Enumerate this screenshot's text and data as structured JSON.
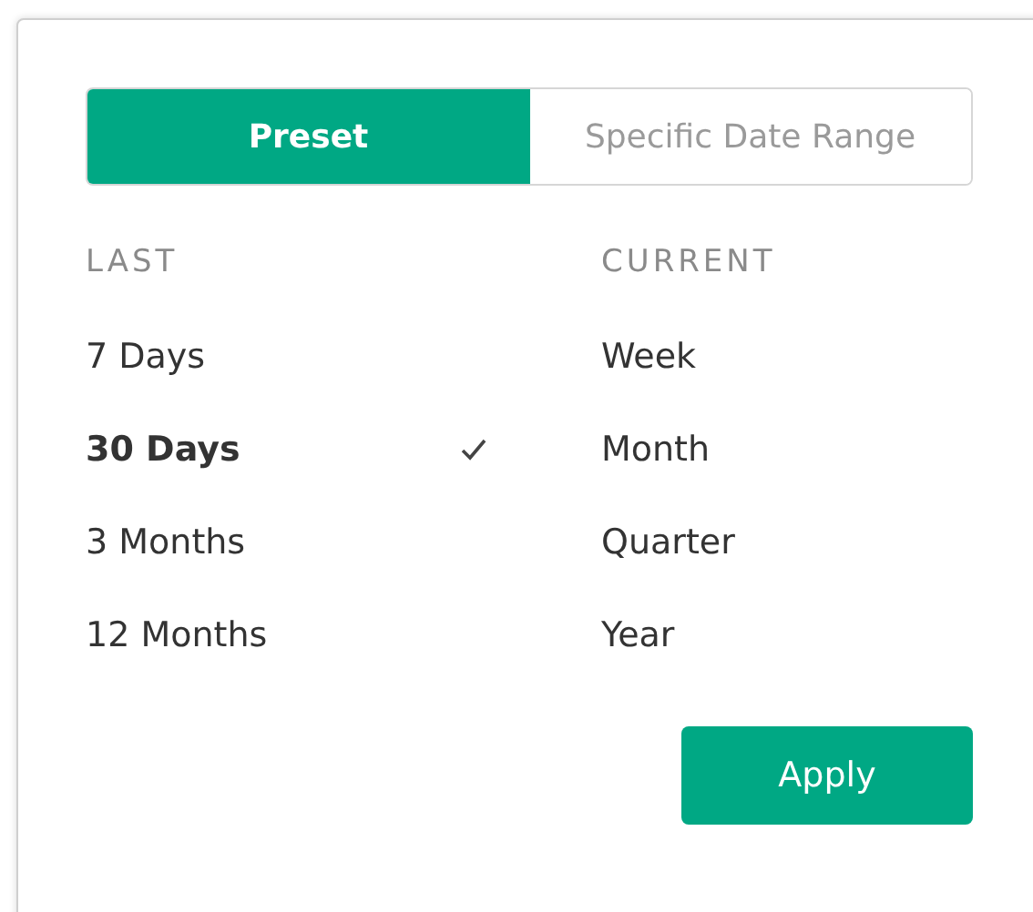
{
  "mode_tabs": [
    {
      "label": "Preset",
      "selected": true
    },
    {
      "label": "Specific Date Range",
      "selected": false
    }
  ],
  "last": {
    "heading": "LAST",
    "items": [
      {
        "label": "7 Days",
        "selected": false
      },
      {
        "label": "30 Days",
        "selected": true
      },
      {
        "label": "3 Months",
        "selected": false
      },
      {
        "label": "12 Months",
        "selected": false
      }
    ]
  },
  "current": {
    "heading": "CURRENT",
    "items": [
      {
        "label": "Week",
        "selected": false
      },
      {
        "label": "Month",
        "selected": false
      },
      {
        "label": "Quarter",
        "selected": false
      },
      {
        "label": "Year",
        "selected": false
      }
    ]
  },
  "apply_button": "Apply"
}
